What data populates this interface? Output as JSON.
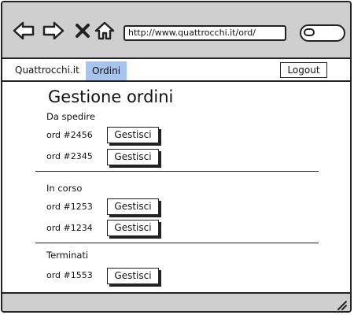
{
  "browser": {
    "url": "http://www.quattrocchi.it/ord/",
    "icons": [
      "back-arrow-icon",
      "forward-arrow-icon",
      "close-icon",
      "home-icon",
      "search-icon"
    ]
  },
  "nav": {
    "brand": "Quattrocchi.it",
    "tab_orders": "Ordini",
    "logout": "Logout",
    "active_tab_color": "#a6c4ee"
  },
  "page": {
    "title": "Gestione ordini"
  },
  "sections": [
    {
      "label": "Da spedire",
      "orders": [
        {
          "id": "ord #2456",
          "action": "Gestisci"
        },
        {
          "id": "ord #2345",
          "action": "Gestisci"
        }
      ]
    },
    {
      "label": "In corso",
      "orders": [
        {
          "id": "ord #1253",
          "action": "Gestisci"
        },
        {
          "id": "ord #1234",
          "action": "Gestisci"
        }
      ]
    },
    {
      "label": "Terminati",
      "orders": [
        {
          "id": "ord #1553",
          "action": "Gestisci"
        }
      ]
    }
  ]
}
